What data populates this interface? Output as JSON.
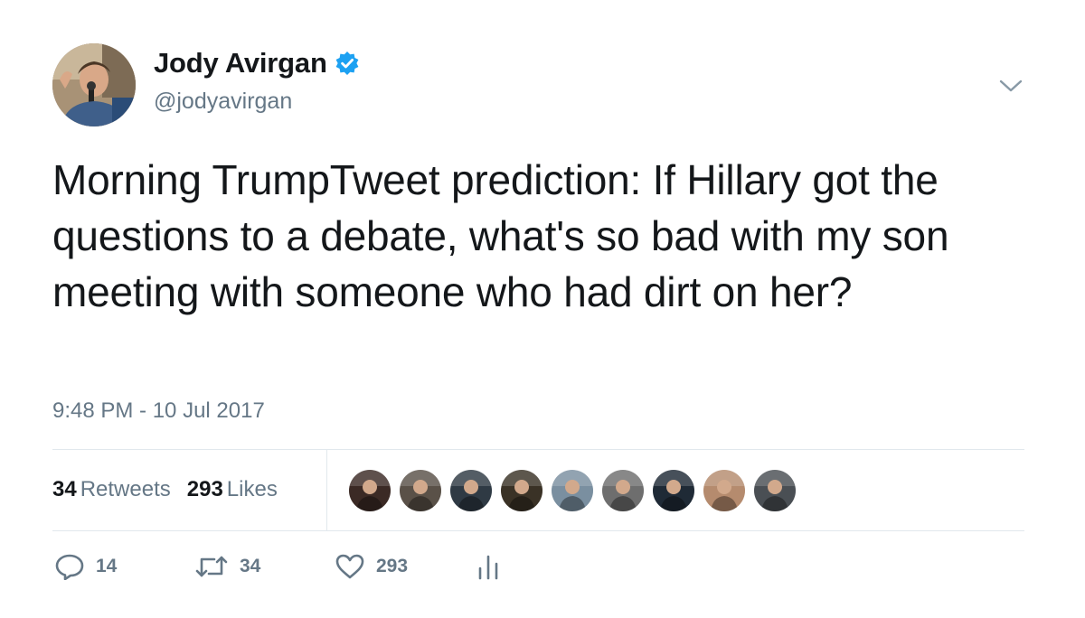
{
  "user": {
    "display_name": "Jody Avirgan",
    "handle": "@jodyavirgan",
    "verified": true,
    "avatar_icon": "profile-photo"
  },
  "tweet": {
    "text": "Morning TrumpTweet prediction: If Hillary got the questions to a debate, what's so bad with my son meeting with someone who had dirt on her?",
    "timestamp": "9:48 PM - 10 Jul 2017"
  },
  "stats": {
    "retweets_count": "34",
    "retweets_label": "Retweets",
    "likes_count": "293",
    "likes_label": "Likes"
  },
  "likers": [
    {
      "icon": "liker-avatar",
      "color": "#3b2a25"
    },
    {
      "icon": "liker-avatar",
      "color": "#5a5148"
    },
    {
      "icon": "liker-avatar",
      "color": "#2f3a44"
    },
    {
      "icon": "liker-avatar",
      "color": "#3a3226"
    },
    {
      "icon": "liker-avatar",
      "color": "#7a8fa0"
    },
    {
      "icon": "liker-avatar",
      "color": "#6e6e6e"
    },
    {
      "icon": "liker-avatar",
      "color": "#1f2a36"
    },
    {
      "icon": "liker-avatar",
      "color": "#b58b6e"
    },
    {
      "icon": "liker-avatar",
      "color": "#4a4f54"
    }
  ],
  "actions": {
    "reply_count": "14",
    "retweet_count": "34",
    "like_count": "293",
    "icons": [
      "reply-icon",
      "retweet-icon",
      "like-icon",
      "analytics-icon"
    ]
  },
  "colors": {
    "text": "#14171a",
    "secondary": "#657786",
    "divider": "#e1e8ed",
    "verified": "#1da1f2"
  }
}
